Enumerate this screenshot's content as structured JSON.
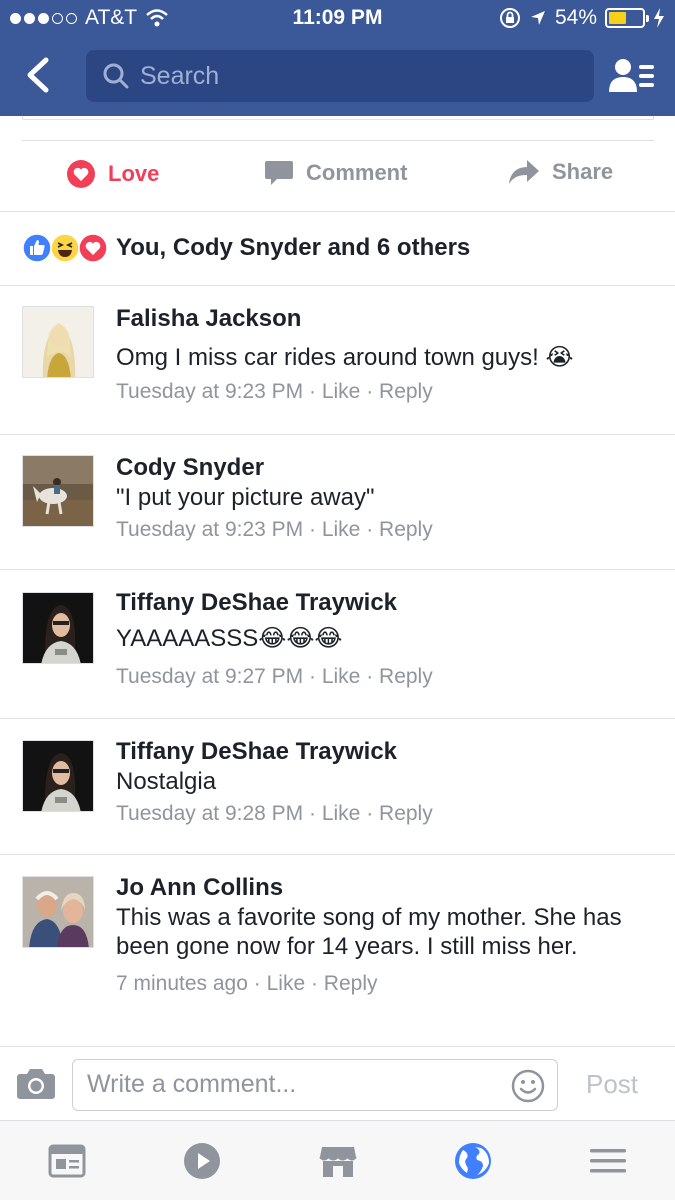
{
  "status_bar": {
    "carrier": "AT&T",
    "time": "11:09 PM",
    "battery": "54%",
    "battery_level": 0.54,
    "signal_bars_filled": 3,
    "signal_bars_total": 5
  },
  "nav": {
    "search_placeholder": "Search",
    "icons": [
      "back-chevron-icon",
      "search-icon",
      "friends-list-icon"
    ]
  },
  "actions": {
    "love_label": "Love",
    "comment_label": "Comment",
    "share_label": "Share"
  },
  "reactions": {
    "summary": "You, Cody Snyder and 6 others",
    "icons": [
      "like-reaction-icon",
      "haha-reaction-icon",
      "love-reaction-icon"
    ]
  },
  "comments": [
    {
      "name": "Falisha Jackson",
      "text": "Omg I miss car rides around town guys! 😭",
      "time": "Tuesday at 9:23 PM",
      "like": "Like",
      "reply": "Reply"
    },
    {
      "name": "Cody Snyder",
      "text": "\"I put your picture away\"",
      "time": "Tuesday at 9:23 PM",
      "like": "Like",
      "reply": "Reply"
    },
    {
      "name": "Tiffany DeShae Traywick",
      "text": "YAAAAASSS😂😂😂",
      "time": "Tuesday at 9:27 PM",
      "like": "Like",
      "reply": "Reply"
    },
    {
      "name": "Tiffany DeShae Traywick",
      "text": "Nostalgia",
      "time": "Tuesday at 9:28 PM",
      "like": "Like",
      "reply": "Reply"
    },
    {
      "name": "Jo Ann Collins",
      "text": "This was a favorite song of my mother. She has been gone now for 14 years. I still miss her.",
      "time": "7 minutes ago",
      "like": "Like",
      "reply": "Reply"
    }
  ],
  "composer": {
    "placeholder": "Write a comment...",
    "post_label": "Post"
  },
  "tabbar": {
    "tabs": [
      "news-feed-icon",
      "video-icon",
      "marketplace-icon",
      "notifications-globe-icon",
      "menu-icon"
    ],
    "active_tab": "notifications-globe-icon"
  },
  "colors": {
    "header_bg": "#3b5998",
    "love_red": "#f33e58",
    "meta_gray": "#90949c",
    "active_blue": "#4080ff"
  }
}
